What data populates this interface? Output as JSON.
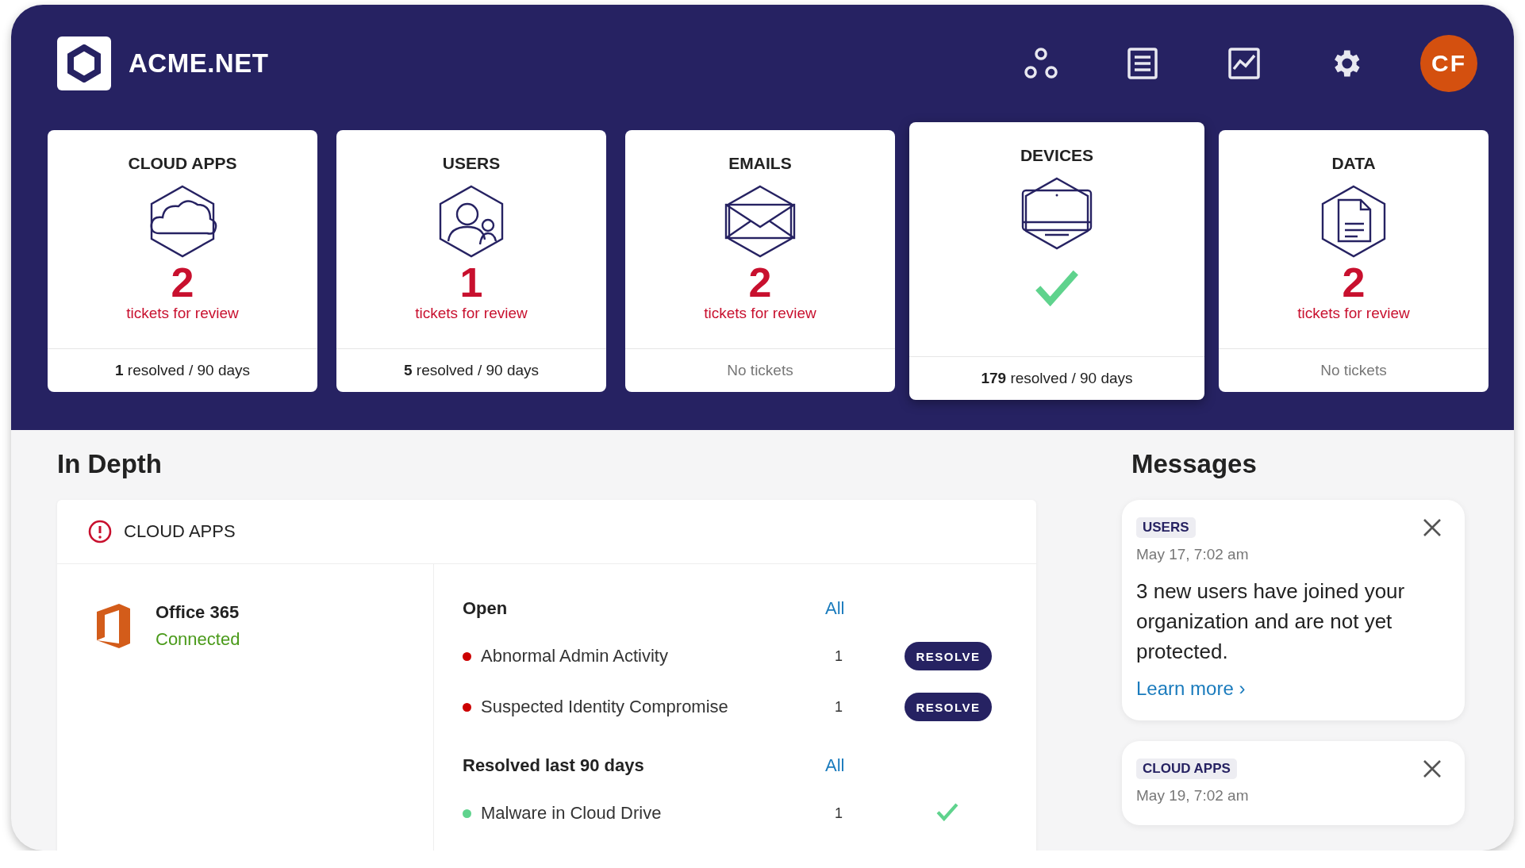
{
  "header": {
    "brand": "ACME.NET",
    "nav_icons": [
      {
        "kind": "nodes"
      },
      {
        "kind": "list"
      },
      {
        "kind": "chart"
      },
      {
        "kind": "settings"
      }
    ],
    "avatar": "CF"
  },
  "summary_cards": [
    {
      "title": "CLOUD APPS",
      "selected": false,
      "kind": "tickets",
      "count": "2",
      "count_label": "tickets for review",
      "footer": "**1** resolved / 90 days"
    },
    {
      "title": "USERS",
      "selected": false,
      "kind": "tickets",
      "count": "1",
      "count_label": "tickets for review",
      "footer": "**5** resolved / 90 days"
    },
    {
      "title": "EMAILS",
      "selected": false,
      "kind": "tickets",
      "count": "2",
      "count_label": "tickets for review",
      "footer": "No tickets",
      "muted": true
    },
    {
      "title": "DEVICES",
      "selected": true,
      "kind": "clear",
      "footer": "**179** resolved / 90 days"
    },
    {
      "title": "DATA",
      "selected": false,
      "kind": "tickets",
      "count": "2",
      "count_label": "tickets for review",
      "footer": "No tickets",
      "muted": true
    }
  ],
  "in_depth": {
    "heading": "In Depth",
    "panel": {
      "title": "CLOUD APPS",
      "app": {
        "name": "Office 365",
        "status": "Connected"
      },
      "sections": [
        {
          "title": "Open",
          "link": "All",
          "rows": [
            {
              "kind": "open",
              "label": "Abnormal Admin Activity",
              "count": "1",
              "color": "#cc0000",
              "action": "RESOLVE"
            },
            {
              "kind": "open",
              "label": "Suspected Identity Compromise",
              "count": "1",
              "color": "#cc0000",
              "action": "RESOLVE"
            }
          ]
        },
        {
          "title": "Resolved last 90 days",
          "link": "All",
          "rows": [
            {
              "kind": "resolved",
              "label": "Malware in Cloud Drive",
              "count": "1",
              "color": "#5fd38d"
            }
          ]
        }
      ]
    }
  },
  "messages": {
    "heading": "Messages",
    "items": [
      {
        "tag": "USERS",
        "date": "May 17, 7:02 am",
        "text": "3 new users have joined your organization and are not yet protected.",
        "link": "Learn more ›"
      },
      {
        "tag": "CLOUD APPS",
        "date": "May 19, 7:02 am"
      }
    ]
  }
}
